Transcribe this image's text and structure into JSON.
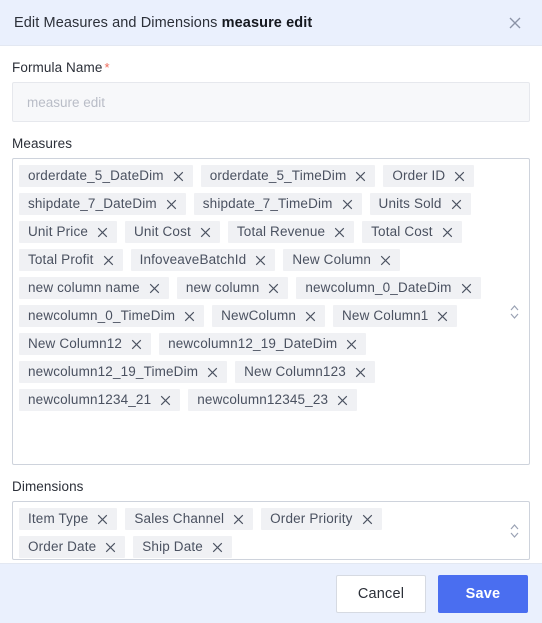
{
  "dialog": {
    "title_prefix": "Edit Measures and Dimensions",
    "title_strong": "measure edit",
    "close_icon": "close-icon"
  },
  "form": {
    "formula_name": {
      "label": "Formula Name",
      "required_marker": "*",
      "value": "",
      "placeholder": "measure edit"
    },
    "measures": {
      "label": "Measures",
      "stepper_icon": "chevron-up-down-icon",
      "chips": [
        "orderdate_5_DateDim",
        "orderdate_5_TimeDim",
        "Order ID",
        "shipdate_7_DateDim",
        "shipdate_7_TimeDim",
        "Units Sold",
        "Unit Price",
        "Unit Cost",
        "Total Revenue",
        "Total Cost",
        "Total Profit",
        "InfoveaveBatchId",
        "New Column",
        "new column name",
        "new column",
        "newcolumn_0_DateDim",
        "newcolumn_0_TimeDim",
        "NewColumn",
        "New Column1",
        "New Column12",
        "newcolumn12_19_DateDim",
        "newcolumn12_19_TimeDim",
        "New Column123",
        "newcolumn1234_21",
        "newcolumn12345_23"
      ]
    },
    "dimensions": {
      "label": "Dimensions",
      "stepper_icon": "chevron-up-down-icon",
      "chips": [
        "Item Type",
        "Sales Channel",
        "Order Priority",
        "Order Date",
        "Ship Date"
      ]
    }
  },
  "footer": {
    "cancel_label": "Cancel",
    "save_label": "Save"
  },
  "colors": {
    "header_bg": "#eaf0fd",
    "footer_bg": "#eaf0fd",
    "save_accent": "#4a6ef0",
    "chip_bg": "#f0f1f4",
    "required_star": "#ef6a5a",
    "box_border": "#ced3dc"
  }
}
